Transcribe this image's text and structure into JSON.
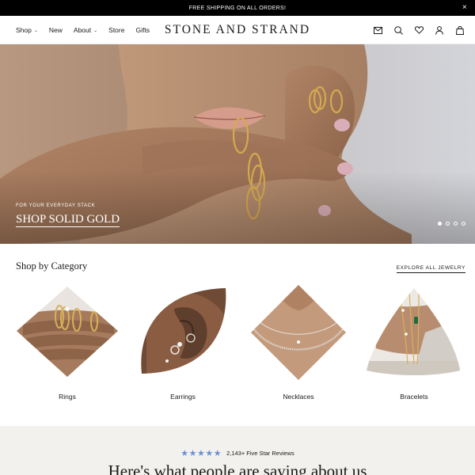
{
  "announcement": {
    "text": "FREE SHIPPING ON ALL ORDERS!",
    "close_icon": "×"
  },
  "header": {
    "logo": "STONE AND STRAND",
    "nav": [
      {
        "label": "Shop",
        "has_dropdown": true
      },
      {
        "label": "New",
        "has_dropdown": false
      },
      {
        "label": "About",
        "has_dropdown": true
      },
      {
        "label": "Store",
        "has_dropdown": false
      },
      {
        "label": "Gifts",
        "has_dropdown": false
      }
    ],
    "icons": [
      "mail-icon",
      "search-icon",
      "heart-icon",
      "account-icon",
      "cart-icon"
    ]
  },
  "hero": {
    "kicker": "FOR YOUR EVERYDAY STACK",
    "cta": "SHOP SOLID GOLD",
    "slides": 4,
    "active_slide": 1
  },
  "categories": {
    "title": "Shop by Category",
    "explore": "EXPLORE ALL JEWELRY",
    "items": [
      {
        "label": "Rings"
      },
      {
        "label": "Earrings"
      },
      {
        "label": "Necklaces"
      },
      {
        "label": "Bracelets"
      }
    ]
  },
  "reviews": {
    "stars": "★★★★★",
    "count": "2,143+ Five Star Reviews",
    "headline": "Here's what people are saying about us"
  },
  "colors": {
    "accent_star": "#6b8fd6",
    "announce_bg": "#000000"
  }
}
